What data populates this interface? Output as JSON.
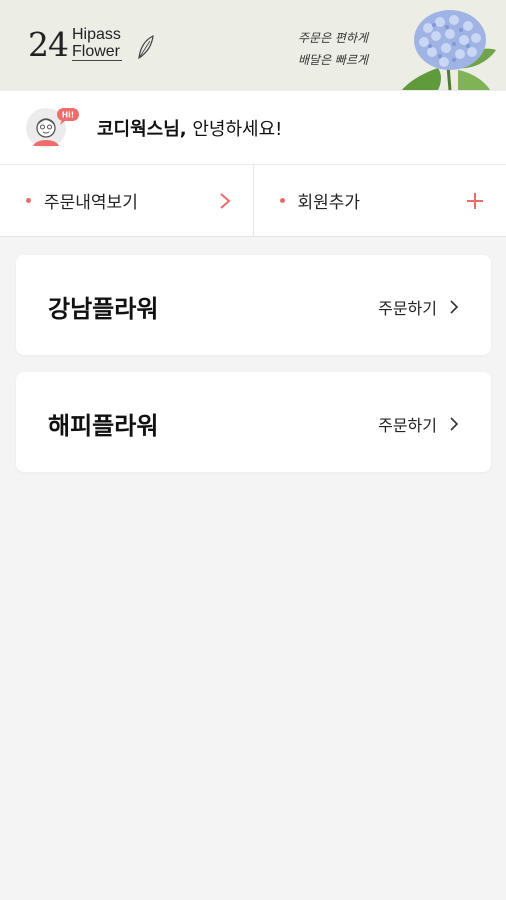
{
  "header": {
    "logo_number": "24",
    "logo_word_1": "Hipass",
    "logo_word_2": "Flower",
    "slogan_line_1": "주문은 편하게",
    "slogan_line_2": "배달은 빠르게"
  },
  "greeting": {
    "avatar_badge": "Hi!",
    "name": "코디웍스님,",
    "message": " 안녕하세요!"
  },
  "actions": [
    {
      "label": "주문내역보기",
      "icon": "chevron-right-icon"
    },
    {
      "label": "회원추가",
      "icon": "plus-icon"
    }
  ],
  "stores": [
    {
      "name": "강남플라워",
      "order_label": "주문하기"
    },
    {
      "name": "해피플라워",
      "order_label": "주문하기"
    }
  ],
  "colors": {
    "accent": "#ec6b6b",
    "header_bg": "#ecede5",
    "page_bg": "#f4f4f4"
  }
}
